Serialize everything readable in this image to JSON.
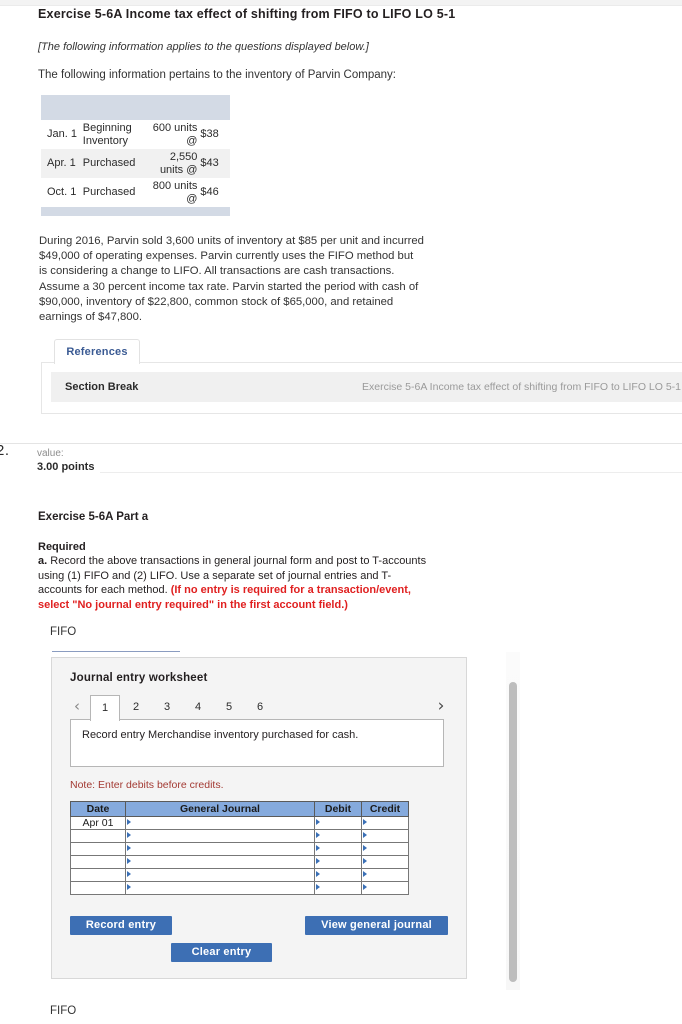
{
  "exercise": {
    "title": "Exercise 5-6A Income tax effect of shifting from FIFO to LIFO LO 5-1",
    "info_note": "[The following information applies to the questions displayed below.]",
    "lead_in": "The following information pertains to the inventory of Parvin Company:"
  },
  "inventory_table": {
    "rows": [
      {
        "date": "Jan. 1",
        "description": "Beginning Inventory",
        "units": "600 units @",
        "price": "$38"
      },
      {
        "date": "Apr. 1",
        "description": "Purchased",
        "units": "2,550 units @",
        "price": "$43"
      },
      {
        "date": "Oct. 1",
        "description": "Purchased",
        "units": "800 units @",
        "price": "$46"
      }
    ]
  },
  "paragraph": "During 2016, Parvin sold 3,600 units of inventory at $85 per unit and incurred $49,000 of operating expenses. Parvin currently uses the FIFO method but is considering a change to LIFO. All transactions are cash transactions. Assume a 30 percent income tax rate. Parvin started the period with cash of $90,000, inventory of $22,800, common stock of $65,000, and retained earnings of $47,800.",
  "references": {
    "tab_label": "References",
    "section_break_label": "Section Break",
    "section_break_right": "Exercise 5-6A Income tax effect of shifting from FIFO to LIFO LO 5-1"
  },
  "question2": {
    "number": "2.",
    "value_label": "value:",
    "points": "3.00 points",
    "part_title": "Exercise 5-6A Part a",
    "required_label": "Required",
    "requirement_bullet": "a.",
    "requirement_text": "Record the above transactions in general journal form and post to T-accounts using (1) FIFO and (2) LIFO. Use a separate set of journal entries and T-accounts for each method.",
    "requirement_red": "(If no entry is required for a transaction/event, select \"No journal entry required\" in the first account field.)",
    "method_label_top": "FIFO",
    "method_label_bottom": "FIFO"
  },
  "worksheet": {
    "title": "Journal entry worksheet",
    "prev_arrow": "‹",
    "next_arrow": "›",
    "tabs": [
      "1",
      "2",
      "3",
      "4",
      "5",
      "6"
    ],
    "active_tab": "1",
    "entry_description": "Record entry Merchandise inventory purchased for cash.",
    "note": "Note: Enter debits before credits.",
    "table": {
      "headers": [
        "Date",
        "General Journal",
        "Debit",
        "Credit"
      ],
      "rows": [
        {
          "date": "Apr 01",
          "general_journal": "",
          "debit": "",
          "credit": ""
        },
        {
          "date": "",
          "general_journal": "",
          "debit": "",
          "credit": ""
        },
        {
          "date": "",
          "general_journal": "",
          "debit": "",
          "credit": ""
        },
        {
          "date": "",
          "general_journal": "",
          "debit": "",
          "credit": ""
        },
        {
          "date": "",
          "general_journal": "",
          "debit": "",
          "credit": ""
        },
        {
          "date": "",
          "general_journal": "",
          "debit": "",
          "credit": ""
        }
      ]
    },
    "buttons": {
      "record": "Record entry",
      "clear": "Clear entry",
      "view": "View general journal"
    }
  },
  "colors": {
    "button_blue": "#3d6fb4",
    "table_header_blue": "#85aadd",
    "alert_red": "#e02020",
    "note_red": "#a33a33",
    "link_blue": "#3a5a93",
    "inventory_bar": "#d3dae5"
  }
}
